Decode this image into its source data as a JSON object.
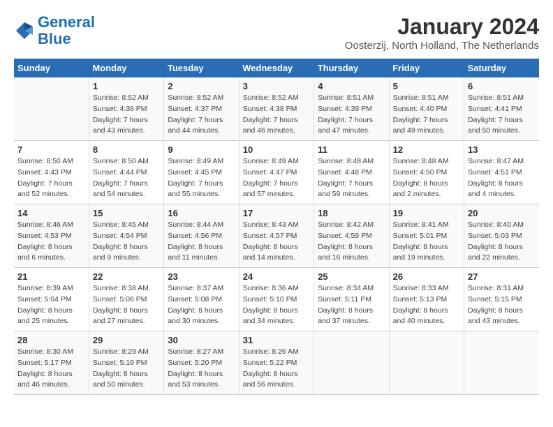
{
  "logo": {
    "line1": "General",
    "line2": "Blue"
  },
  "title": "January 2024",
  "subtitle": "Oosterzij, North Holland, The Netherlands",
  "days_header": [
    "Sunday",
    "Monday",
    "Tuesday",
    "Wednesday",
    "Thursday",
    "Friday",
    "Saturday"
  ],
  "weeks": [
    [
      {
        "day": "",
        "sunrise": "",
        "sunset": "",
        "daylight": ""
      },
      {
        "day": "1",
        "sunrise": "Sunrise: 8:52 AM",
        "sunset": "Sunset: 4:36 PM",
        "daylight": "Daylight: 7 hours and 43 minutes."
      },
      {
        "day": "2",
        "sunrise": "Sunrise: 8:52 AM",
        "sunset": "Sunset: 4:37 PM",
        "daylight": "Daylight: 7 hours and 44 minutes."
      },
      {
        "day": "3",
        "sunrise": "Sunrise: 8:52 AM",
        "sunset": "Sunset: 4:38 PM",
        "daylight": "Daylight: 7 hours and 46 minutes."
      },
      {
        "day": "4",
        "sunrise": "Sunrise: 8:51 AM",
        "sunset": "Sunset: 4:39 PM",
        "daylight": "Daylight: 7 hours and 47 minutes."
      },
      {
        "day": "5",
        "sunrise": "Sunrise: 8:51 AM",
        "sunset": "Sunset: 4:40 PM",
        "daylight": "Daylight: 7 hours and 49 minutes."
      },
      {
        "day": "6",
        "sunrise": "Sunrise: 8:51 AM",
        "sunset": "Sunset: 4:41 PM",
        "daylight": "Daylight: 7 hours and 50 minutes."
      }
    ],
    [
      {
        "day": "7",
        "sunrise": "Sunrise: 8:50 AM",
        "sunset": "Sunset: 4:43 PM",
        "daylight": "Daylight: 7 hours and 52 minutes."
      },
      {
        "day": "8",
        "sunrise": "Sunrise: 8:50 AM",
        "sunset": "Sunset: 4:44 PM",
        "daylight": "Daylight: 7 hours and 54 minutes."
      },
      {
        "day": "9",
        "sunrise": "Sunrise: 8:49 AM",
        "sunset": "Sunset: 4:45 PM",
        "daylight": "Daylight: 7 hours and 55 minutes."
      },
      {
        "day": "10",
        "sunrise": "Sunrise: 8:49 AM",
        "sunset": "Sunset: 4:47 PM",
        "daylight": "Daylight: 7 hours and 57 minutes."
      },
      {
        "day": "11",
        "sunrise": "Sunrise: 8:48 AM",
        "sunset": "Sunset: 4:48 PM",
        "daylight": "Daylight: 7 hours and 59 minutes."
      },
      {
        "day": "12",
        "sunrise": "Sunrise: 8:48 AM",
        "sunset": "Sunset: 4:50 PM",
        "daylight": "Daylight: 8 hours and 2 minutes."
      },
      {
        "day": "13",
        "sunrise": "Sunrise: 8:47 AM",
        "sunset": "Sunset: 4:51 PM",
        "daylight": "Daylight: 8 hours and 4 minutes."
      }
    ],
    [
      {
        "day": "14",
        "sunrise": "Sunrise: 8:46 AM",
        "sunset": "Sunset: 4:53 PM",
        "daylight": "Daylight: 8 hours and 6 minutes."
      },
      {
        "day": "15",
        "sunrise": "Sunrise: 8:45 AM",
        "sunset": "Sunset: 4:54 PM",
        "daylight": "Daylight: 8 hours and 9 minutes."
      },
      {
        "day": "16",
        "sunrise": "Sunrise: 8:44 AM",
        "sunset": "Sunset: 4:56 PM",
        "daylight": "Daylight: 8 hours and 11 minutes."
      },
      {
        "day": "17",
        "sunrise": "Sunrise: 8:43 AM",
        "sunset": "Sunset: 4:57 PM",
        "daylight": "Daylight: 8 hours and 14 minutes."
      },
      {
        "day": "18",
        "sunrise": "Sunrise: 8:42 AM",
        "sunset": "Sunset: 4:59 PM",
        "daylight": "Daylight: 8 hours and 16 minutes."
      },
      {
        "day": "19",
        "sunrise": "Sunrise: 8:41 AM",
        "sunset": "Sunset: 5:01 PM",
        "daylight": "Daylight: 8 hours and 19 minutes."
      },
      {
        "day": "20",
        "sunrise": "Sunrise: 8:40 AM",
        "sunset": "Sunset: 5:03 PM",
        "daylight": "Daylight: 8 hours and 22 minutes."
      }
    ],
    [
      {
        "day": "21",
        "sunrise": "Sunrise: 8:39 AM",
        "sunset": "Sunset: 5:04 PM",
        "daylight": "Daylight: 8 hours and 25 minutes."
      },
      {
        "day": "22",
        "sunrise": "Sunrise: 8:38 AM",
        "sunset": "Sunset: 5:06 PM",
        "daylight": "Daylight: 8 hours and 27 minutes."
      },
      {
        "day": "23",
        "sunrise": "Sunrise: 8:37 AM",
        "sunset": "Sunset: 5:08 PM",
        "daylight": "Daylight: 8 hours and 30 minutes."
      },
      {
        "day": "24",
        "sunrise": "Sunrise: 8:36 AM",
        "sunset": "Sunset: 5:10 PM",
        "daylight": "Daylight: 8 hours and 34 minutes."
      },
      {
        "day": "25",
        "sunrise": "Sunrise: 8:34 AM",
        "sunset": "Sunset: 5:11 PM",
        "daylight": "Daylight: 8 hours and 37 minutes."
      },
      {
        "day": "26",
        "sunrise": "Sunrise: 8:33 AM",
        "sunset": "Sunset: 5:13 PM",
        "daylight": "Daylight: 8 hours and 40 minutes."
      },
      {
        "day": "27",
        "sunrise": "Sunrise: 8:31 AM",
        "sunset": "Sunset: 5:15 PM",
        "daylight": "Daylight: 8 hours and 43 minutes."
      }
    ],
    [
      {
        "day": "28",
        "sunrise": "Sunrise: 8:30 AM",
        "sunset": "Sunset: 5:17 PM",
        "daylight": "Daylight: 8 hours and 46 minutes."
      },
      {
        "day": "29",
        "sunrise": "Sunrise: 8:29 AM",
        "sunset": "Sunset: 5:19 PM",
        "daylight": "Daylight: 8 hours and 50 minutes."
      },
      {
        "day": "30",
        "sunrise": "Sunrise: 8:27 AM",
        "sunset": "Sunset: 5:20 PM",
        "daylight": "Daylight: 8 hours and 53 minutes."
      },
      {
        "day": "31",
        "sunrise": "Sunrise: 8:26 AM",
        "sunset": "Sunset: 5:22 PM",
        "daylight": "Daylight: 8 hours and 56 minutes."
      },
      {
        "day": "",
        "sunrise": "",
        "sunset": "",
        "daylight": ""
      },
      {
        "day": "",
        "sunrise": "",
        "sunset": "",
        "daylight": ""
      },
      {
        "day": "",
        "sunrise": "",
        "sunset": "",
        "daylight": ""
      }
    ]
  ]
}
